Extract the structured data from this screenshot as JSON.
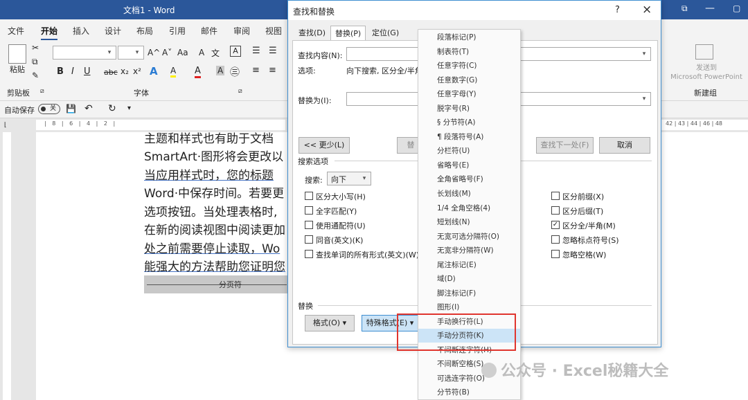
{
  "window": {
    "title": "文档1 - Word"
  },
  "ribbon_tabs": [
    "文件",
    "开始",
    "插入",
    "设计",
    "布局",
    "引用",
    "邮件",
    "审阅",
    "视图"
  ],
  "ribbon": {
    "paste_label": "粘贴",
    "clipboard_group": "剪贴板",
    "font_group": "字体",
    "font_buttons": [
      "B",
      "I",
      "U",
      "abc",
      "x₂",
      "x²",
      "A",
      "A",
      "A",
      "A"
    ],
    "size_buttons": [
      "A^",
      "A˅",
      "Aa",
      "A"
    ],
    "send_to_ppt": "发送到\nMicrosoft PowerPoint",
    "new_group": "新建组"
  },
  "qat": {
    "autosave_label": "自动保存",
    "toggle_text": "关"
  },
  "ruler_left": "| 8 | 6 | 4 | 2 |",
  "ruler_right": "42 | 43 | 44 | 46 | 48",
  "document": {
    "lines": [
      "主题和样式也有助于文档",
      "SmartArt·图形将会更改以",
      "当应用样式时，您的标题",
      "Word·中保存时间。若要更",
      "选项按钮。当处理表格时,",
      "在新的阅读视图中阅读更加",
      "处之前需要停止读取，Wo",
      "能强大的方法帮助您证明您"
    ],
    "page_break": "分页符"
  },
  "dialog": {
    "title": "查找和替换",
    "help": "?",
    "close": "×",
    "tabs": [
      "查找(D)",
      "替换(P)",
      "定位(G)"
    ],
    "active_tab": 1,
    "find_label": "查找内容(N):",
    "options_label": "选项:",
    "options_value": "向下搜索, 区分全/半角",
    "replace_label": "替换为(I):",
    "less_button": "<< 更少(L)",
    "replace_button": "替",
    "find_next_button": "查找下一处(F)",
    "cancel_button": "取消",
    "search_options_title": "搜索选项",
    "search_label": "搜索:",
    "search_value": "向下",
    "left_checks": [
      {
        "label": "区分大小写(H)",
        "checked": false
      },
      {
        "label": "全字匹配(Y)",
        "checked": false
      },
      {
        "label": "使用通配符(U)",
        "checked": false
      },
      {
        "label": "同音(英文)(K)",
        "checked": false
      },
      {
        "label": "查找单词的所有形式(英文)(W)",
        "checked": false
      }
    ],
    "right_checks": [
      {
        "label": "区分前缀(X)",
        "checked": false
      },
      {
        "label": "区分后缀(T)",
        "checked": false
      },
      {
        "label": "区分全/半角(M)",
        "checked": true
      },
      {
        "label": "忽略标点符号(S)",
        "checked": false
      },
      {
        "label": "忽略空格(W)",
        "checked": false
      }
    ],
    "replace_section": "替换",
    "format_button": "格式(O) ▾",
    "special_button": "特殊格式(E) ▾"
  },
  "special_menu": {
    "items": [
      "段落标记(P)",
      "制表符(T)",
      "任意字符(C)",
      "任意数字(G)",
      "任意字母(Y)",
      "脱字号(R)",
      "§ 分节符(A)",
      "¶ 段落符号(A)",
      "分栏符(U)",
      "省略号(E)",
      "全角省略号(F)",
      "长划线(M)",
      "1/4 全角空格(4)",
      "短划线(N)",
      "无宽可选分隔符(O)",
      "无宽非分隔符(W)",
      "尾注标记(E)",
      "域(D)",
      "脚注标记(F)",
      "图形(I)",
      "手动换行符(L)",
      "手动分页符(K)",
      "不间断连字符(H)",
      "不间断空格(S)",
      "可选连字符(O)",
      "分节符(B)"
    ],
    "highlighted_index": 21
  },
  "watermark": "公众号 · Excel秘籍大全",
  "colors": {
    "title_bar": "#2b579a",
    "highlight": "#cce4f7",
    "red_box": "#e0342d"
  }
}
